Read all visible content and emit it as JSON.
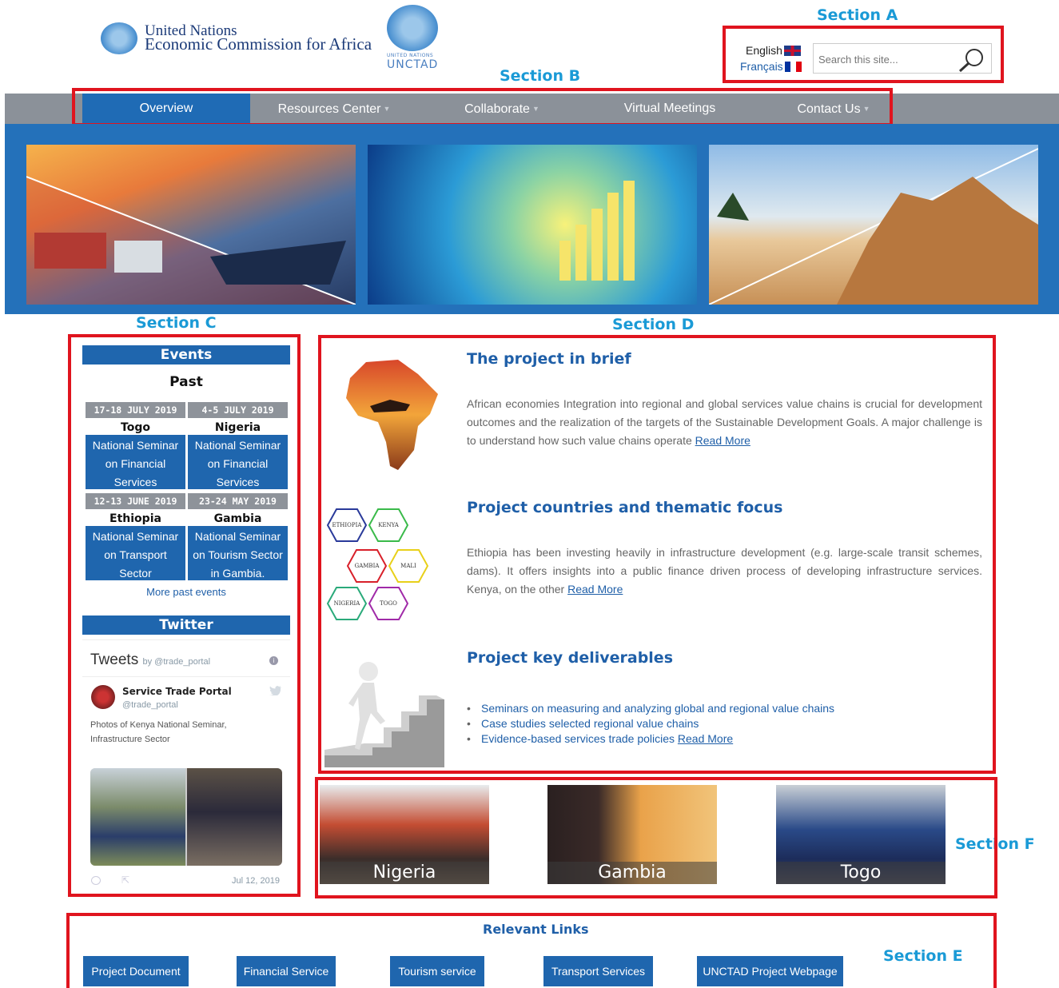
{
  "annotations": {
    "section_a": "Section A",
    "section_b": "Section B",
    "section_c": "Section C",
    "section_d": "Section D",
    "section_e": "Section E",
    "section_f": "Section F"
  },
  "header": {
    "org_line1": "United Nations",
    "org_line2": "Economic Commission for Africa",
    "unctad_small": "UNITED NATIONS",
    "unctad": "UNCTAD",
    "lang_en": "English",
    "lang_fr": "Français",
    "search_placeholder": "Search this site..."
  },
  "nav": [
    {
      "label": "Overview",
      "active": true,
      "dropdown": false
    },
    {
      "label": "Resources Center",
      "active": false,
      "dropdown": true
    },
    {
      "label": "Collaborate",
      "active": false,
      "dropdown": true
    },
    {
      "label": "Virtual Meetings",
      "active": false,
      "dropdown": false
    },
    {
      "label": "Contact Us",
      "active": false,
      "dropdown": true
    }
  ],
  "events": {
    "title": "Events",
    "subtitle": "Past",
    "items": [
      {
        "date": "17-18 JULY 2019",
        "country": "Togo",
        "title": [
          "National Seminar",
          "on Financial",
          "Services"
        ]
      },
      {
        "date": "4-5 JULY 2019",
        "country": "Nigeria",
        "title": [
          "National Seminar",
          "on Financial",
          "Services"
        ]
      },
      {
        "date": "12-13 JUNE 2019",
        "country": "Ethiopia",
        "title": [
          "National Seminar",
          "on Transport",
          "Sector"
        ]
      },
      {
        "date": "23-24 MAY 2019",
        "country": "Gambia",
        "title": [
          "National Seminar",
          "on Tourism Sector",
          "in Gambia."
        ]
      }
    ],
    "more": "More past events"
  },
  "twitter": {
    "title": "Twitter",
    "tweets": "Tweets",
    "by": "by @trade_portal",
    "account_name": "Service Trade Portal",
    "handle": "@trade_portal",
    "text": "Photos of Kenya National Seminar, Infrastructure Sector",
    "date": "Jul 12, 2019"
  },
  "content": {
    "brief_title": "The project in brief",
    "brief_body": "African economies Integration into regional and global services value chains is crucial for development outcomes and the realization of the targets of the Sustainable Development Goals. A major challenge is to understand how such value chains operate",
    "countries_title": "Project countries and thematic focus",
    "countries_body": "Ethiopia has been investing heavily in infrastructure development (e.g. large-scale transit schemes, dams). It offers insights into a public finance driven process of developing infrastructure services. Kenya, on the other",
    "hex_labels": [
      "ETHIOPIA",
      "KENYA",
      "GAMBIA",
      "MALI",
      "NIGERIA",
      "TOGO"
    ],
    "deliverables_title": "Project key deliverables",
    "deliverables": [
      "Seminars on measuring and analyzing global and regional value chains",
      "Case studies selected regional value chains",
      "Evidence-based services trade policies"
    ],
    "read_more": "Read More"
  },
  "photos": [
    "Nigeria",
    "Gambia",
    "Togo"
  ],
  "relevant_links": {
    "title": "Relevant Links",
    "items": [
      "Project Document",
      "Financial Service",
      "Tourism service",
      "Transport Services",
      "UNCTAD Project Webpage"
    ]
  },
  "colors": {
    "accent_blue": "#1f66ae",
    "nav_gray": "#8b9199",
    "annotation_red": "#e0141e",
    "annotation_blue": "#1a9ad6"
  }
}
